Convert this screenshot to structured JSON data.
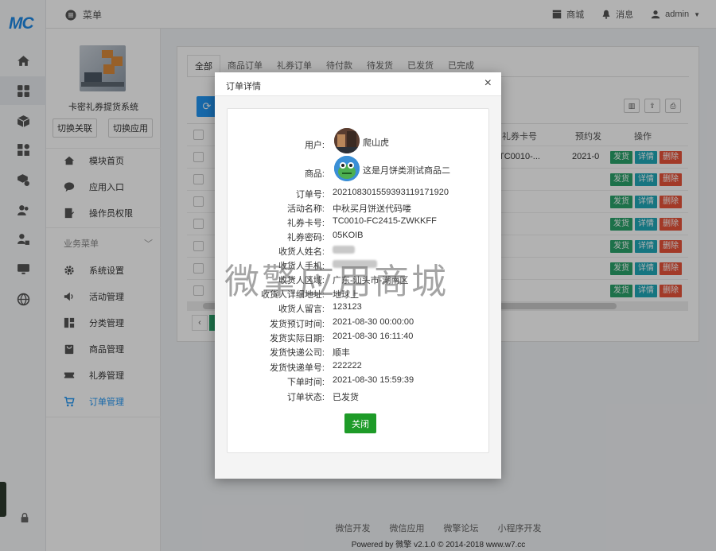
{
  "brand": {
    "logo_text": "MC"
  },
  "topbar": {
    "menu_label": "菜单",
    "store_label": "商城",
    "messages_label": "消息",
    "user_label": "admin"
  },
  "sidenav": {
    "system_name": "卡密礼券提货系统",
    "switch_relation": "切换关联",
    "switch_app": "切换应用",
    "top_items": [
      "模块首页",
      "应用入口",
      "操作员权限"
    ],
    "group_title": "业务菜单",
    "group_items": [
      "系统设置",
      "活动管理",
      "分类管理",
      "商品管理",
      "礼券管理",
      "订单管理"
    ],
    "active_item": "订单管理"
  },
  "content": {
    "tabs": [
      "全部",
      "商品订单",
      "礼券订单",
      "待付款",
      "待发货",
      "已发货",
      "已完成"
    ],
    "active_tab": "全部",
    "columns": {
      "coupon_no": "礼券卡号",
      "reserve": "预约发",
      "ops": "操作"
    },
    "first_row": {
      "coupon_no": "TC0010-...",
      "reserve": "2021-0"
    },
    "row_actions": {
      "ship": "发货",
      "detail": "详情",
      "delete": "删除"
    },
    "row_count": 7
  },
  "modal": {
    "title": "订单详情",
    "close_icon": "×",
    "fields": [
      {
        "label": "用户:",
        "value": "爬山虎"
      },
      {
        "label": "商品:",
        "value": "这是月饼类测试商品二"
      },
      {
        "label": "订单号:",
        "value": "20210830155939311917192​0"
      },
      {
        "label": "活动名称:",
        "value": "中秋买月饼送代码喽"
      },
      {
        "label": "礼券卡号:",
        "value": "TC0010-FC2415-ZWKKFF"
      },
      {
        "label": "礼券密码:",
        "value": "05KOIB"
      },
      {
        "label": "收货人姓名:",
        "value": ""
      },
      {
        "label": "收货人手机:",
        "value": ""
      },
      {
        "label": "收货人区域:",
        "value": "广东-汕头市-潮南区"
      },
      {
        "label": "收货人详细地址:",
        "value": "地球上"
      },
      {
        "label": "收货人留言:",
        "value": "123123"
      },
      {
        "label": "发货预订时间:",
        "value": "2021-08-30 00:00:00"
      },
      {
        "label": "发货实际日期:",
        "value": "2021-08-30 16:11:40"
      },
      {
        "label": "发货快递公司:",
        "value": "顺丰"
      },
      {
        "label": "发货快递单号:",
        "value": "222222"
      },
      {
        "label": "下单时间:",
        "value": "2021-08-30 15:59:39"
      },
      {
        "label": "订单状态:",
        "value": "已发货"
      }
    ],
    "close_button": "关闭"
  },
  "watermark": "微擎应用商城",
  "footer": {
    "links": [
      "微信开发",
      "微信应用",
      "微擎论坛",
      "小程序开发"
    ],
    "copyright": "Powered by 微擎 v2.1.0 © 2014-2018 www.w7.cc"
  },
  "colors": {
    "primary": "#2196f3",
    "success": "#1e9b28",
    "info": "#20a8b8",
    "danger": "#e8533a"
  }
}
